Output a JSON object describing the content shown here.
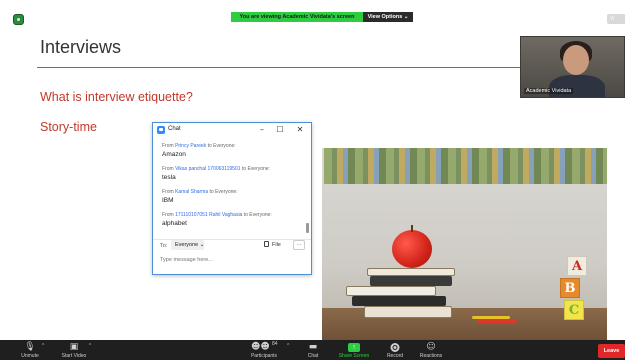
{
  "top_bar": {
    "viewing_banner": "You are viewing Academic Vividata's screen",
    "view_options_label": "View Options ⌄",
    "right_button_label": "Vi"
  },
  "slide": {
    "title": "Interviews",
    "subheading_1": "What is interview etiquette?",
    "subheading_2": "Story-time"
  },
  "participant_video": {
    "name": "Academic Vividata"
  },
  "chat": {
    "title": "Chat",
    "minimize": "–",
    "maximize": "☐",
    "close": "✕",
    "messages": [
      {
        "from_prefix": "From",
        "sender": "Princy Pareek",
        "to_text": "to Everyone:",
        "text": "Amazon"
      },
      {
        "from_prefix": "From",
        "sender": "Vikas panchal 170063119501",
        "to_text": "to Everyone:",
        "text": "tesla"
      },
      {
        "from_prefix": "From",
        "sender": "Kamal Sharma",
        "to_text": "to Everyone:",
        "text": "IBM"
      },
      {
        "from_prefix": "From",
        "sender": "171110107051 Rahil Vaghasia",
        "to_text": "to Everyone:",
        "text": "alphabet"
      }
    ],
    "to_label": "To:",
    "recipient": "Everyone ⌄",
    "file_label": "File",
    "more_label": "···",
    "input_placeholder": "Type message here..."
  },
  "photo_blocks": [
    "A",
    "B",
    "C"
  ],
  "toolbar": {
    "unmute_label": "Unmute",
    "start_video_label": "Start Video",
    "participants_label": "Participants",
    "participants_count": "84",
    "chat_label": "Chat",
    "share_screen_label": "Share Screen",
    "record_label": "Record",
    "reactions_label": "Reactions",
    "leave_label": "Leave",
    "caret": "^"
  },
  "colors": {
    "accent_red": "#c0392b",
    "zoom_green": "#2ecc40",
    "leave_red": "#e02828",
    "link_blue": "#2d6ee0"
  }
}
